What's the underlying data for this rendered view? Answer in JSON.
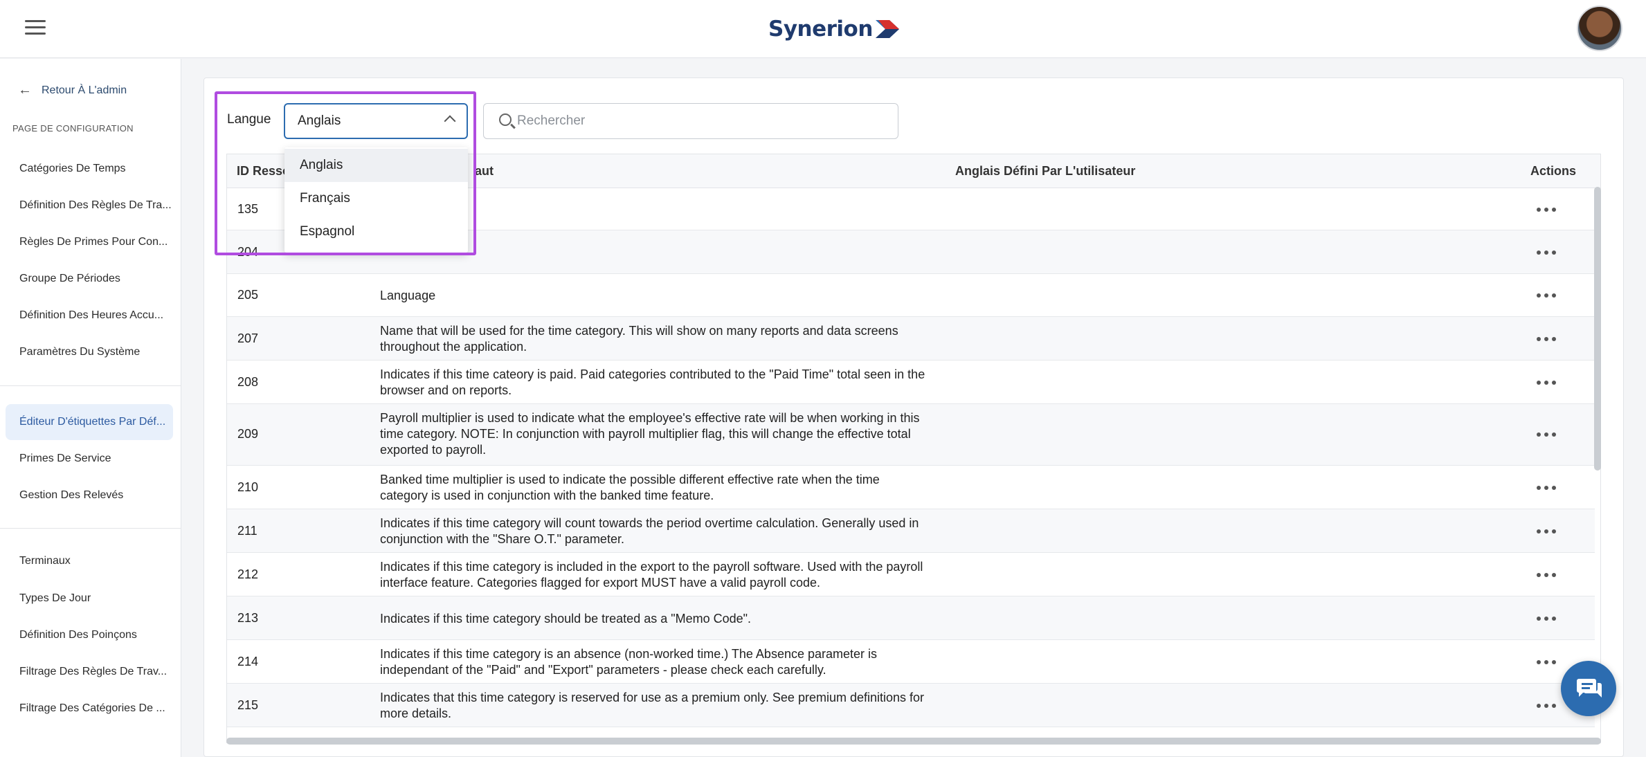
{
  "header": {
    "brand": "Synerion",
    "brand_colors": {
      "navy": "#1f3b6e",
      "red": "#d6312e",
      "blue": "#2c6cb0"
    }
  },
  "sidebar": {
    "back_label": "Retour À L'admin",
    "section_label": "PAGE DE CONFIGURATION",
    "group1": [
      "Catégories De Temps",
      "Définition Des Règles De Tra...",
      "Règles De Primes Pour Con...",
      "Groupe De Périodes",
      "Définition Des Heures Accu...",
      "Paramètres Du Système"
    ],
    "group2": [
      "Éditeur D'étiquettes Par Déf...",
      "Primes De Service",
      "Gestion Des Relevés"
    ],
    "group3": [
      "Terminaux",
      "Types De Jour",
      "Définition Des Poinçons",
      "Filtrage Des Règles De Trav...",
      "Filtrage Des Catégories De ..."
    ]
  },
  "filters": {
    "language_label": "Langue",
    "language_value": "Anglais",
    "search_placeholder": "Rechercher",
    "language_options": [
      "Anglais",
      "Français",
      "Espagnol"
    ]
  },
  "table": {
    "columns": {
      "id": "ID Resso",
      "default": "aut",
      "user": "Anglais Défini Par L'utilisateur",
      "actions": "Actions"
    },
    "rows": [
      {
        "id": "135",
        "text": ""
      },
      {
        "id": "204",
        "text": ""
      },
      {
        "id": "205",
        "text": "Language"
      },
      {
        "id": "207",
        "text": "Name that will be used for the time category. This will show on many reports and data screens throughout the application."
      },
      {
        "id": "208",
        "text": "Indicates if this time cateory is paid. Paid categories contributed to the \"Paid Time\" total seen in the browser and on reports."
      },
      {
        "id": "209",
        "text": "Payroll multiplier is used to indicate what the employee's effective rate will be when working in this time category. NOTE: In conjunction with payroll multiplier flag, this will change the effective total exported to payroll."
      },
      {
        "id": "210",
        "text": "Banked time multiplier is used to indicate the possible different effective rate when the time category is used in conjunction with the banked time feature."
      },
      {
        "id": "211",
        "text": "Indicates if this time category will count towards the period overtime calculation. Generally used in conjunction with the \"Share O.T.\" parameter."
      },
      {
        "id": "212",
        "text": "Indicates if this time category is included in the export to the payroll software. Used with the payroll interface feature. Categories flagged for export MUST have a valid payroll code."
      },
      {
        "id": "213",
        "text": "Indicates if this time category should be treated as a \"Memo Code\"."
      },
      {
        "id": "214",
        "text": "Indicates if this time category is an absence (non-worked time.) The Absence parameter is independant of the \"Paid\" and \"Export\" parameters - please check each carefully."
      },
      {
        "id": "215",
        "text": "Indicates that this time category is reserved for use as a premium only. See premium definitions for more details."
      }
    ]
  }
}
